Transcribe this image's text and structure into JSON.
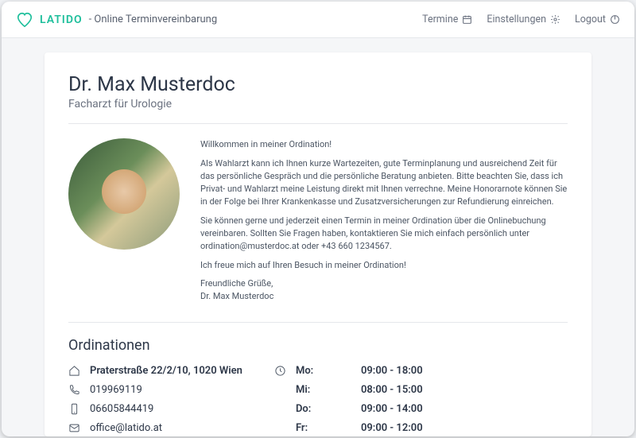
{
  "brand": "LATIDO",
  "subtitle": "- Online Terminvereinbarung",
  "nav": {
    "termine": "Termine",
    "einstellungen": "Einstellungen",
    "logout": "Logout"
  },
  "doctor": {
    "name": "Dr. Max Musterdoc",
    "specialty": "Facharzt für Urologie"
  },
  "intro": {
    "p1": "Willkommen in meiner Ordination!",
    "p2": "Als Wahlarzt kann ich Ihnen kurze Wartezeiten, gute Terminplanung und ausreichend Zeit für das persönliche Gespräch und die persönliche Beratung anbieten. Bitte beachten Sie, dass ich Privat- und Wahlarzt meine Leistung direkt mit Ihnen verrechne. Meine Honorarnote können Sie in der Folge bei Ihrer Krankenkasse und Zusatzversicherungen zur Refundierung einreichen.",
    "p3": "Sie können gerne und jederzeit einen Termin in meiner Ordination über die Onlinebuchung vereinbaren. Sollten Sie Fragen haben, kontaktieren Sie mich einfach persönlich unter ordination@musterdoc.at oder +43 660 1234567.",
    "p4": "Ich freue mich auf Ihren Besuch in meiner Ordination!",
    "p5": "Freundliche Grüße,",
    "p6": "Dr. Max Musterdoc"
  },
  "ordinationen": {
    "title": "Ordinationen",
    "address": "Praterstraße 22/2/10, 1020 Wien",
    "phone": "019969119",
    "mobile": "06605844419",
    "email": "office@latido.at",
    "hours": [
      {
        "day": "Mo:",
        "time": "09:00 - 18:00"
      },
      {
        "day": "Mi:",
        "time": "08:00 - 15:00"
      },
      {
        "day": "Do:",
        "time": "09:00 - 14:00"
      },
      {
        "day": "Fr:",
        "time": "09:00 - 12:00"
      }
    ]
  }
}
